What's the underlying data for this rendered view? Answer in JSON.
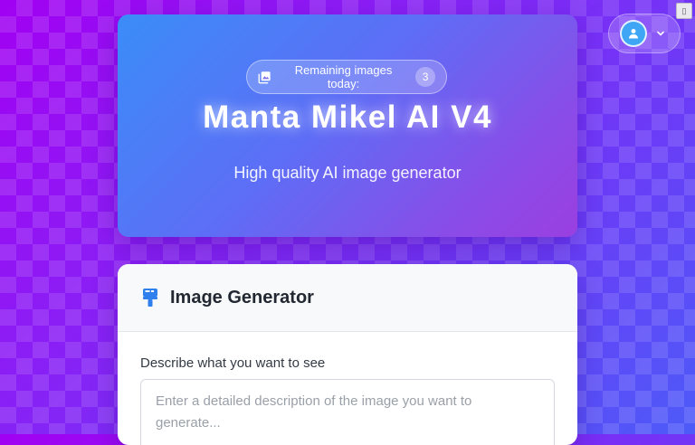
{
  "header": {
    "remaining_label": "Remaining images today:",
    "remaining_count": "3",
    "title": "Manta Mikel AI V4",
    "subtitle": "High quality AI image generator"
  },
  "user_menu": {
    "avatar_icon": "user-icon",
    "dropdown_icon": "chevron-down-icon"
  },
  "corner_tab": {
    "glyph": "▯"
  },
  "generator": {
    "title": "Image Generator",
    "icon": "paint-roller-icon",
    "prompt_label": "Describe what you want to see",
    "prompt_placeholder": "Enter a detailed description of the image you want to generate...",
    "prompt_value": ""
  },
  "colors": {
    "background_start": "#a100f2",
    "background_end": "#4d5bf8",
    "hero_start": "#3a8df8",
    "hero_end": "#9a3fe0",
    "avatar": "#3ea6f5",
    "accent_icon": "#2f80ed"
  }
}
